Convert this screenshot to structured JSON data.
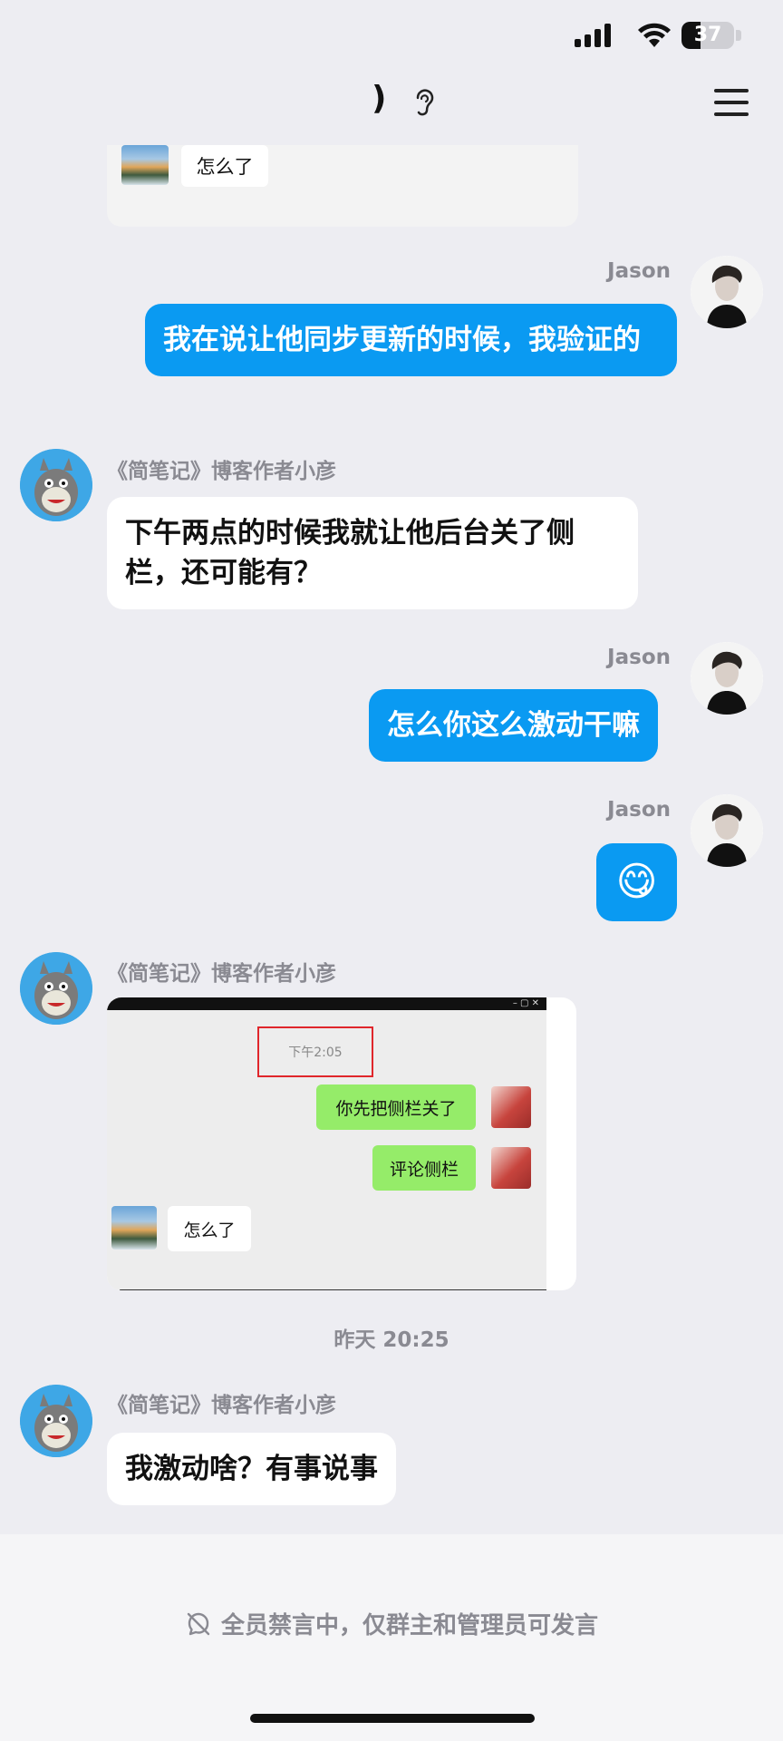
{
  "status_bar": {
    "battery": "37",
    "battery_level": 0.37
  },
  "header": {
    "title_fragment": ")",
    "ear_icon": "ear-icon",
    "menu_icon": "menu-icon"
  },
  "top_crop": {
    "reply": "怎么了"
  },
  "messages": [
    {
      "sender": "Jason",
      "side": "right",
      "text": "我在说让他同步更新的时候，我验证的"
    },
    {
      "sender": "《简笔记》博客作者小彦",
      "side": "left",
      "text": "下午两点的时候我就让他后台关了侧栏，还可能有？"
    },
    {
      "sender": "Jason",
      "side": "right",
      "text": "怎么你这么激动干嘛"
    },
    {
      "sender": "Jason",
      "side": "right",
      "emoji": "😋"
    },
    {
      "sender": "《简笔记》博客作者小彦",
      "side": "left",
      "type": "image"
    },
    {
      "sender": "《简笔记》博客作者小彦",
      "side": "left",
      "text": "我激动啥？有事说事"
    }
  ],
  "screenshot": {
    "time_label": "下午2:05",
    "msg1": "你先把侧栏关了",
    "msg2": "评论侧栏",
    "msg3": "怎么了"
  },
  "timestamp": "昨天 20:25",
  "footer": {
    "notice": "全员禁言中，仅群主和管理员可发言"
  },
  "colors": {
    "bubble_right": "#0A9AF2",
    "bubble_left": "#FFFFFF",
    "background": "#EDEDF2",
    "green_bubble": "#95EC69"
  }
}
